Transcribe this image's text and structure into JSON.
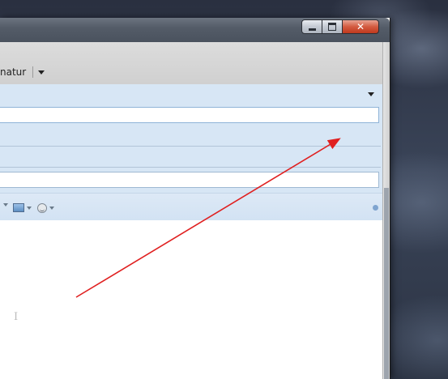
{
  "toolbar": {
    "signature_label": "natur"
  },
  "fields": {
    "to_value": "",
    "subject_value": ""
  },
  "titlebar": {
    "close_glyph": "✕"
  },
  "colors": {
    "accent_header": "#d7e6f5",
    "close_button": "#c0391e",
    "annotation_arrow": "#e02020"
  },
  "icons": [
    "minimize-icon",
    "maximize-icon",
    "close-icon",
    "dropdown-icon",
    "picture-icon",
    "emoticon-icon",
    "status-dot-icon",
    "text-cursor-icon"
  ]
}
